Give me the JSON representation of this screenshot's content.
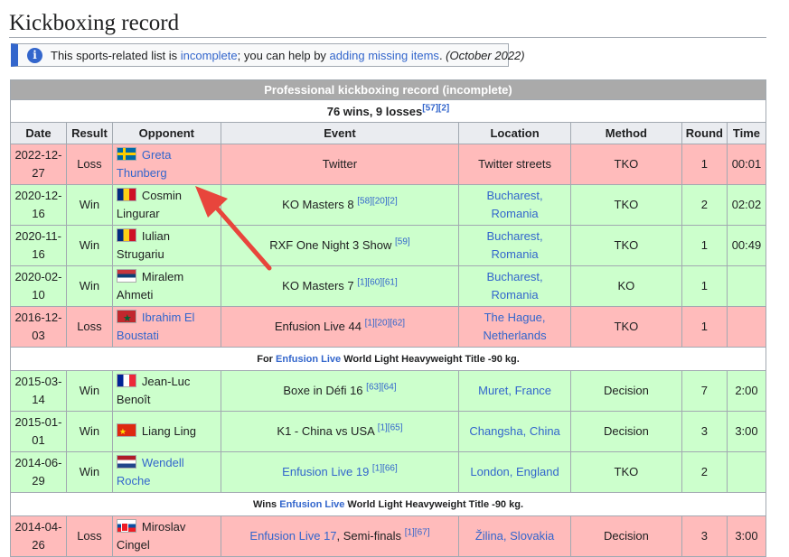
{
  "heading": "Kickboxing record",
  "notice": {
    "prefix": "This sports-related list is ",
    "link1": "incomplete",
    "middle": "; you can help by ",
    "link2": "adding missing items",
    "suffix": ". ",
    "date": "(October 2022)"
  },
  "table": {
    "caption": "Professional kickboxing record (incomplete)",
    "summary": "76 wins, 9 losses",
    "summary_refs": "[57][2]",
    "headers": [
      "Date",
      "Result",
      "Opponent",
      "Event",
      "Location",
      "Method",
      "Round",
      "Time"
    ],
    "rows": [
      {
        "result_class": "loss",
        "date": "2022-12-27",
        "result": "Loss",
        "flag": "se",
        "opponent": "Greta Thunberg",
        "opponent_link": true,
        "event": "Twitter",
        "event_refs": "",
        "event_link": false,
        "location": "Twitter streets",
        "location_link": false,
        "method": "TKO",
        "round": "1",
        "time": "00:01"
      },
      {
        "result_class": "win",
        "date": "2020-12-16",
        "result": "Win",
        "flag": "ro",
        "opponent": "Cosmin Lingurar",
        "opponent_link": false,
        "event": "KO Masters 8",
        "event_refs": "[58][20][2]",
        "event_link": false,
        "location": "Bucharest, Romania",
        "location_link": true,
        "method": "TKO",
        "round": "2",
        "time": "02:02"
      },
      {
        "result_class": "win",
        "date": "2020-11-16",
        "result": "Win",
        "flag": "ro",
        "opponent": "Iulian Strugariu",
        "opponent_link": false,
        "event": "RXF One Night 3 Show",
        "event_refs": "[59]",
        "event_link": false,
        "location": "Bucharest, Romania",
        "location_link": true,
        "method": "TKO",
        "round": "1",
        "time": "00:49"
      },
      {
        "result_class": "win",
        "date": "2020-02-10",
        "result": "Win",
        "flag": "rs",
        "opponent": "Miralem Ahmeti",
        "opponent_link": false,
        "event": "KO Masters 7",
        "event_refs": "[1][60][61]",
        "event_link": false,
        "location": "Bucharest, Romania",
        "location_link": true,
        "method": "KO",
        "round": "1",
        "time": ""
      },
      {
        "result_class": "loss",
        "date": "2016-12-03",
        "result": "Loss",
        "flag": "ma",
        "opponent": "Ibrahim El Boustati",
        "opponent_link": true,
        "event": "Enfusion Live 44",
        "event_refs": "[1][20][62]",
        "event_link": false,
        "location": "The Hague, Netherlands",
        "location_link": true,
        "method": "TKO",
        "round": "1",
        "time": ""
      }
    ],
    "note1": {
      "prefix": "For ",
      "link": "Enfusion Live",
      "suffix": " World Light Heavyweight Title -90 kg."
    },
    "rows2": [
      {
        "result_class": "win",
        "date": "2015-03-14",
        "result": "Win",
        "flag": "fr",
        "opponent": "Jean-Luc Benoît",
        "opponent_link": false,
        "event": "Boxe in Défi 16",
        "event_refs": "[63][64]",
        "event_link": false,
        "location": "Muret, France",
        "location_link": true,
        "method": "Decision",
        "round": "7",
        "time": "2:00"
      },
      {
        "result_class": "win",
        "date": "2015-01-01",
        "result": "Win",
        "flag": "cn",
        "opponent": "Liang Ling",
        "opponent_link": false,
        "event": "K1 - China vs USA",
        "event_refs": "[1][65]",
        "event_link": false,
        "location": "Changsha, China",
        "location_link": true,
        "method": "Decision",
        "round": "3",
        "time": "3:00"
      },
      {
        "result_class": "win",
        "date": "2014-06-29",
        "result": "Win",
        "flag": "nl",
        "opponent": "Wendell Roche",
        "opponent_link": true,
        "event": "Enfusion Live 19",
        "event_refs": "[1][66]",
        "event_link": true,
        "location": "London, England",
        "location_link": true,
        "method": "TKO",
        "round": "2",
        "time": ""
      }
    ],
    "note2": {
      "prefix": "Wins ",
      "link": "Enfusion Live",
      "suffix": " World Light Heavyweight Title -90 kg."
    },
    "rows3": [
      {
        "result_class": "loss",
        "date": "2014-04-26",
        "result": "Loss",
        "flag": "sk",
        "opponent": "Miroslav Cingel",
        "opponent_link": false,
        "event": "Enfusion Live 17",
        "event_suffix": ", Semi-finals",
        "event_refs": "[1][67]",
        "event_link": true,
        "location": "Žilina, Slovakia",
        "location_link": true,
        "method": "Decision",
        "round": "3",
        "time": "3:00"
      }
    ]
  },
  "colors": {
    "loss": "#ffbbbb",
    "win": "#ccffcc",
    "link": "#3366cc",
    "annotation_arrow": "#e8453c"
  }
}
